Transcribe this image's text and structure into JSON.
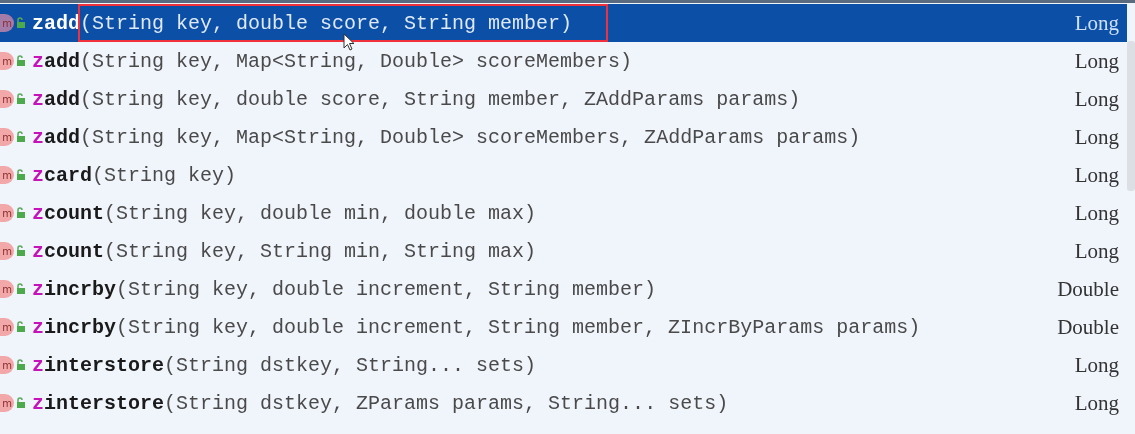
{
  "items": [
    {
      "badge": "m",
      "match": "z",
      "rest": "add",
      "params": "(String key, double score, String member)",
      "type": "Long",
      "selected": true
    },
    {
      "badge": "m",
      "match": "z",
      "rest": "add",
      "params": "(String key, Map<String, Double> scoreMembers)",
      "type": "Long",
      "selected": false
    },
    {
      "badge": "m",
      "match": "z",
      "rest": "add",
      "params": "(String key, double score, String member, ZAddParams params)",
      "type": "Long",
      "selected": false
    },
    {
      "badge": "m",
      "match": "z",
      "rest": "add",
      "params": "(String key, Map<String, Double> scoreMembers, ZAddParams params)",
      "type": "Long",
      "selected": false
    },
    {
      "badge": "m",
      "match": "z",
      "rest": "card",
      "params": "(String key)",
      "type": "Long",
      "selected": false
    },
    {
      "badge": "m",
      "match": "z",
      "rest": "count",
      "params": "(String key, double min, double max)",
      "type": "Long",
      "selected": false
    },
    {
      "badge": "m",
      "match": "z",
      "rest": "count",
      "params": "(String key, String min, String max)",
      "type": "Long",
      "selected": false
    },
    {
      "badge": "m",
      "match": "z",
      "rest": "incrby",
      "params": "(String key, double increment, String member)",
      "type": "Double",
      "selected": false
    },
    {
      "badge": "m",
      "match": "z",
      "rest": "incrby",
      "params": "(String key, double increment, String member, ZIncrByParams params)",
      "type": "Double",
      "selected": false
    },
    {
      "badge": "m",
      "match": "z",
      "rest": "interstore",
      "params": "(String dstkey, String... sets)",
      "type": "Long",
      "selected": false
    },
    {
      "badge": "m",
      "match": "z",
      "rest": "interstore",
      "params": "(String dstkey, ZParams params, String... sets)",
      "type": "Long",
      "selected": false
    }
  ]
}
